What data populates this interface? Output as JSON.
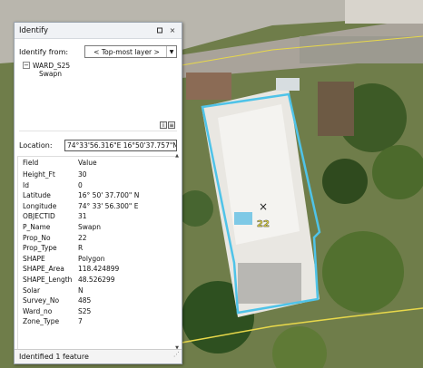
{
  "panel": {
    "title": "Identify",
    "pin_icon": "pin-icon",
    "close_symbol": "×",
    "identify_from_label": "Identify from:",
    "identify_from_value": "< Top-most layer >",
    "tree": {
      "layer": "WARD_S25",
      "feature": "Swapn",
      "expand_symbol": "−"
    },
    "location_label": "Location:",
    "location_value": "74°33'56.316\"E  16°50'37.757\"N",
    "columns": {
      "field": "Field",
      "value": "Value"
    },
    "rows": [
      {
        "field": "Height_Ft",
        "value": "30"
      },
      {
        "field": "Id",
        "value": "0"
      },
      {
        "field": "Latitude",
        "value": "16° 50' 37.700\" N"
      },
      {
        "field": "Longitude",
        "value": "74° 33' 56.300\" E"
      },
      {
        "field": "OBJECTID",
        "value": "31"
      },
      {
        "field": "P_Name",
        "value": "Swapn"
      },
      {
        "field": "Prop_No",
        "value": "22"
      },
      {
        "field": "Prop_Type",
        "value": "R"
      },
      {
        "field": "SHAPE",
        "value": "Polygon"
      },
      {
        "field": "SHAPE_Area",
        "value": "118.424899"
      },
      {
        "field": "SHAPE_Length",
        "value": "48.526299"
      },
      {
        "field": "Solar",
        "value": "N"
      },
      {
        "field": "Survey_No",
        "value": "485"
      },
      {
        "field": "Ward_no",
        "value": "S25"
      },
      {
        "field": "Zone_Type",
        "value": "7"
      }
    ],
    "status": "Identified 1 feature"
  },
  "map": {
    "parcel_label": "22",
    "cursor_symbol": "×",
    "highlight_color": "#4fc3e8",
    "boundary_color": "#e8d84a"
  }
}
